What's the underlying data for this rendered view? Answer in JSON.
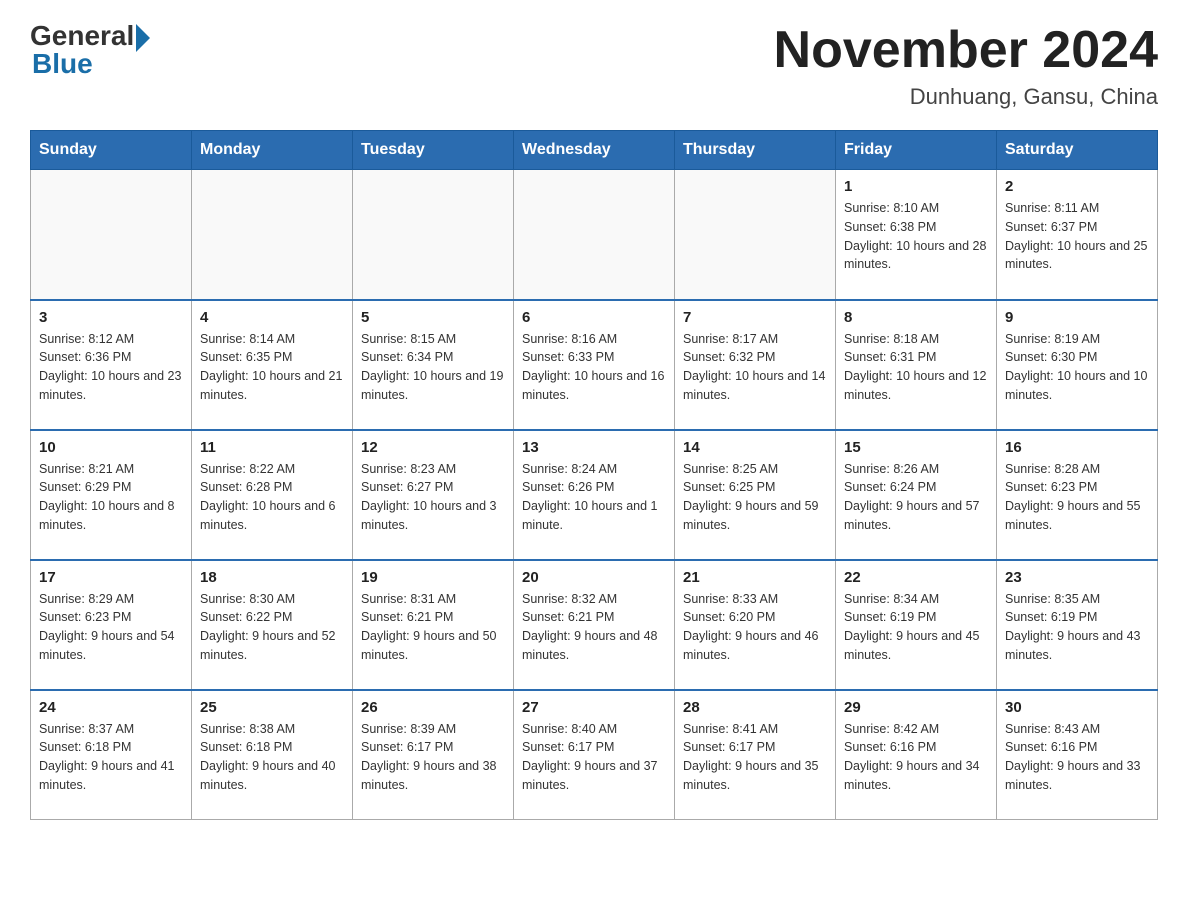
{
  "logo": {
    "general": "General",
    "blue": "Blue"
  },
  "header": {
    "month": "November 2024",
    "location": "Dunhuang, Gansu, China"
  },
  "days_of_week": [
    "Sunday",
    "Monday",
    "Tuesday",
    "Wednesday",
    "Thursday",
    "Friday",
    "Saturday"
  ],
  "weeks": [
    [
      {
        "day": "",
        "info": ""
      },
      {
        "day": "",
        "info": ""
      },
      {
        "day": "",
        "info": ""
      },
      {
        "day": "",
        "info": ""
      },
      {
        "day": "",
        "info": ""
      },
      {
        "day": "1",
        "info": "Sunrise: 8:10 AM\nSunset: 6:38 PM\nDaylight: 10 hours and 28 minutes."
      },
      {
        "day": "2",
        "info": "Sunrise: 8:11 AM\nSunset: 6:37 PM\nDaylight: 10 hours and 25 minutes."
      }
    ],
    [
      {
        "day": "3",
        "info": "Sunrise: 8:12 AM\nSunset: 6:36 PM\nDaylight: 10 hours and 23 minutes."
      },
      {
        "day": "4",
        "info": "Sunrise: 8:14 AM\nSunset: 6:35 PM\nDaylight: 10 hours and 21 minutes."
      },
      {
        "day": "5",
        "info": "Sunrise: 8:15 AM\nSunset: 6:34 PM\nDaylight: 10 hours and 19 minutes."
      },
      {
        "day": "6",
        "info": "Sunrise: 8:16 AM\nSunset: 6:33 PM\nDaylight: 10 hours and 16 minutes."
      },
      {
        "day": "7",
        "info": "Sunrise: 8:17 AM\nSunset: 6:32 PM\nDaylight: 10 hours and 14 minutes."
      },
      {
        "day": "8",
        "info": "Sunrise: 8:18 AM\nSunset: 6:31 PM\nDaylight: 10 hours and 12 minutes."
      },
      {
        "day": "9",
        "info": "Sunrise: 8:19 AM\nSunset: 6:30 PM\nDaylight: 10 hours and 10 minutes."
      }
    ],
    [
      {
        "day": "10",
        "info": "Sunrise: 8:21 AM\nSunset: 6:29 PM\nDaylight: 10 hours and 8 minutes."
      },
      {
        "day": "11",
        "info": "Sunrise: 8:22 AM\nSunset: 6:28 PM\nDaylight: 10 hours and 6 minutes."
      },
      {
        "day": "12",
        "info": "Sunrise: 8:23 AM\nSunset: 6:27 PM\nDaylight: 10 hours and 3 minutes."
      },
      {
        "day": "13",
        "info": "Sunrise: 8:24 AM\nSunset: 6:26 PM\nDaylight: 10 hours and 1 minute."
      },
      {
        "day": "14",
        "info": "Sunrise: 8:25 AM\nSunset: 6:25 PM\nDaylight: 9 hours and 59 minutes."
      },
      {
        "day": "15",
        "info": "Sunrise: 8:26 AM\nSunset: 6:24 PM\nDaylight: 9 hours and 57 minutes."
      },
      {
        "day": "16",
        "info": "Sunrise: 8:28 AM\nSunset: 6:23 PM\nDaylight: 9 hours and 55 minutes."
      }
    ],
    [
      {
        "day": "17",
        "info": "Sunrise: 8:29 AM\nSunset: 6:23 PM\nDaylight: 9 hours and 54 minutes."
      },
      {
        "day": "18",
        "info": "Sunrise: 8:30 AM\nSunset: 6:22 PM\nDaylight: 9 hours and 52 minutes."
      },
      {
        "day": "19",
        "info": "Sunrise: 8:31 AM\nSunset: 6:21 PM\nDaylight: 9 hours and 50 minutes."
      },
      {
        "day": "20",
        "info": "Sunrise: 8:32 AM\nSunset: 6:21 PM\nDaylight: 9 hours and 48 minutes."
      },
      {
        "day": "21",
        "info": "Sunrise: 8:33 AM\nSunset: 6:20 PM\nDaylight: 9 hours and 46 minutes."
      },
      {
        "day": "22",
        "info": "Sunrise: 8:34 AM\nSunset: 6:19 PM\nDaylight: 9 hours and 45 minutes."
      },
      {
        "day": "23",
        "info": "Sunrise: 8:35 AM\nSunset: 6:19 PM\nDaylight: 9 hours and 43 minutes."
      }
    ],
    [
      {
        "day": "24",
        "info": "Sunrise: 8:37 AM\nSunset: 6:18 PM\nDaylight: 9 hours and 41 minutes."
      },
      {
        "day": "25",
        "info": "Sunrise: 8:38 AM\nSunset: 6:18 PM\nDaylight: 9 hours and 40 minutes."
      },
      {
        "day": "26",
        "info": "Sunrise: 8:39 AM\nSunset: 6:17 PM\nDaylight: 9 hours and 38 minutes."
      },
      {
        "day": "27",
        "info": "Sunrise: 8:40 AM\nSunset: 6:17 PM\nDaylight: 9 hours and 37 minutes."
      },
      {
        "day": "28",
        "info": "Sunrise: 8:41 AM\nSunset: 6:17 PM\nDaylight: 9 hours and 35 minutes."
      },
      {
        "day": "29",
        "info": "Sunrise: 8:42 AM\nSunset: 6:16 PM\nDaylight: 9 hours and 34 minutes."
      },
      {
        "day": "30",
        "info": "Sunrise: 8:43 AM\nSunset: 6:16 PM\nDaylight: 9 hours and 33 minutes."
      }
    ]
  ]
}
